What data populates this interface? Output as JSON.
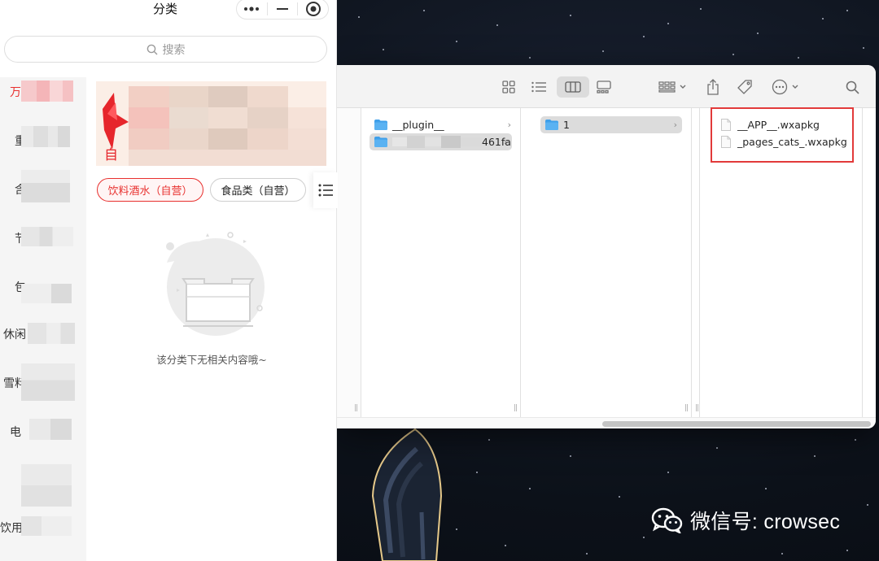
{
  "desktop": {
    "watermark_text": "微信号: crowsec",
    "watermark_icon": "wechat-icon"
  },
  "finder": {
    "toolbar_icons": [
      "icon-view-icon",
      "list-view-icon",
      "column-view-icon",
      "gallery-view-icon",
      "group-icon",
      "share-icon",
      "tag-icon",
      "more-actions-icon",
      "search-icon"
    ],
    "columns": [
      {
        "items": [
          {
            "name": "__plugin__",
            "type": "folder",
            "selected": false
          },
          {
            "name": "461fa",
            "type": "folder",
            "selected": true
          }
        ]
      },
      {
        "items": [
          {
            "name": "1",
            "type": "folder",
            "selected": true
          }
        ]
      },
      {
        "items": [
          {
            "name": "__APP__.wxapkg",
            "type": "file"
          },
          {
            "name": "_pages_cats_.wxapkg",
            "type": "file"
          }
        ]
      }
    ],
    "highlight_color": "#e23a3a"
  },
  "miniprogram": {
    "title": "分类",
    "search_placeholder": "搜索",
    "sidebar": [
      {
        "label": "万",
        "active": true
      },
      {
        "label": "重"
      },
      {
        "label": "含"
      },
      {
        "label": "节"
      },
      {
        "label": "包"
      },
      {
        "label": "休闲"
      },
      {
        "label": "雪料"
      },
      {
        "label": "电"
      },
      {
        "label": ""
      },
      {
        "label": "饮用"
      }
    ],
    "banner_badge": "自",
    "chips": [
      {
        "label": "饮料酒水（自营）",
        "active": true
      },
      {
        "label": "食品类（自营）",
        "active": false
      }
    ],
    "empty_text": "该分类下无相关内容哦~",
    "accent_color": "#e8312f"
  }
}
